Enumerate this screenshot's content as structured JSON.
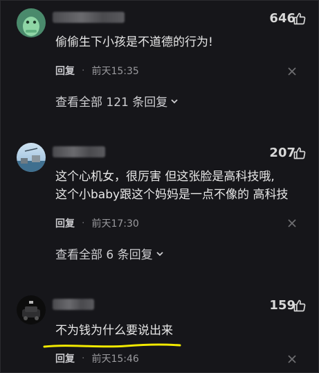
{
  "comments": [
    {
      "likes": "646",
      "text_lines": [
        "偷偷生下小孩是不道德的行为!"
      ],
      "reply_label": "回复",
      "time": "前天15:35",
      "view_all": "查看全部 121 条回复"
    },
    {
      "likes": "207",
      "text_lines": [
        "这个心机女，很厉害 但这张脸是高科技哦,",
        "这个小baby跟这个妈妈是一点不像的 高科技"
      ],
      "reply_label": "回复",
      "time": "前天17:30",
      "view_all": "查看全部 6 条回复"
    },
    {
      "likes": "159",
      "text_lines": [
        "不为钱为什么要说出来"
      ],
      "reply_label": "回复",
      "time": "前天15:46"
    }
  ],
  "colors": {
    "background": "#16161a",
    "highlight": "#f2ea00"
  }
}
